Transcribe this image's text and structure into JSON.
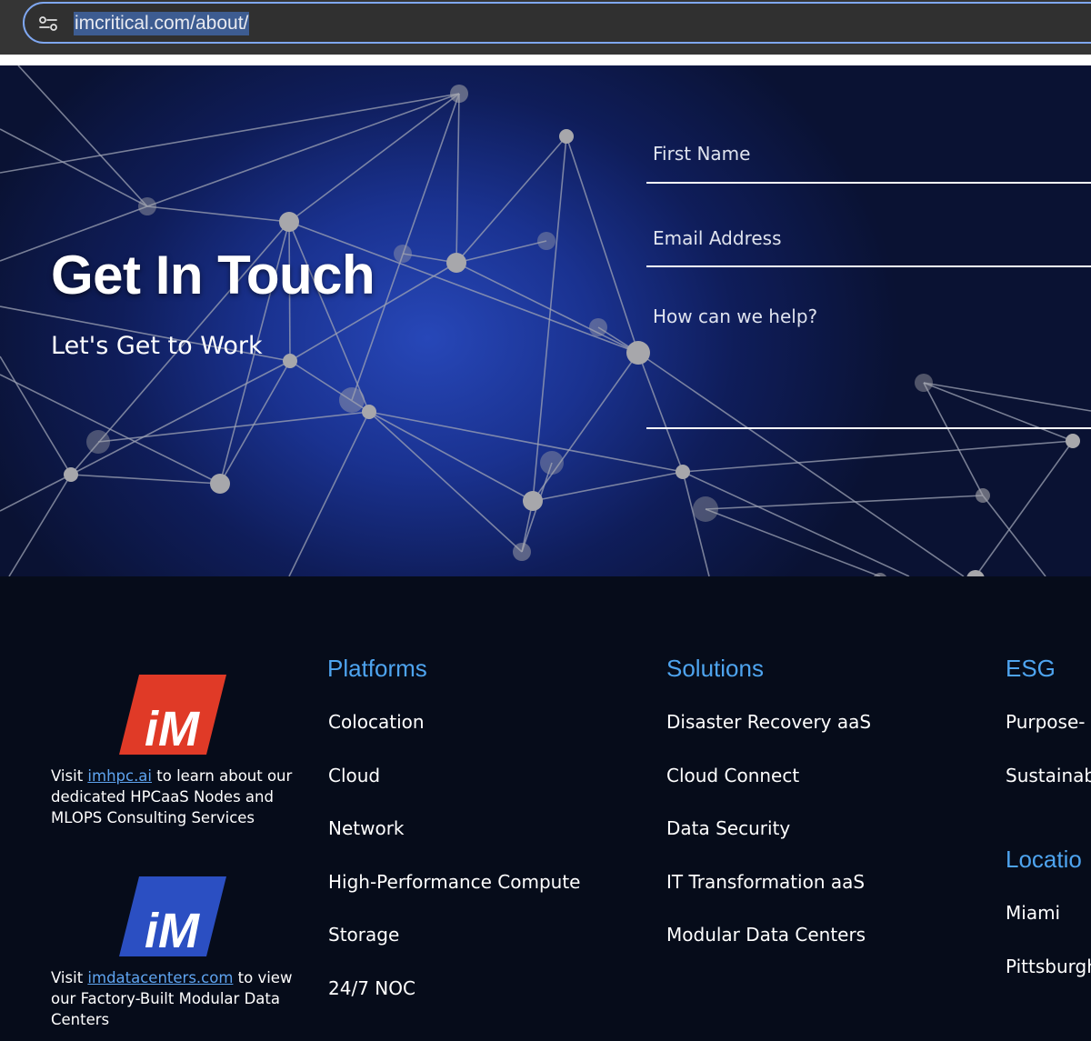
{
  "browser": {
    "url": "imcritical.com/about/",
    "site_settings_icon": "tune-icon"
  },
  "hero": {
    "title": "Get In Touch",
    "subtitle": "Let's Get to Work",
    "form": {
      "first_name_placeholder": "First Name",
      "email_placeholder": "Email Address",
      "help_placeholder": "How can we help?"
    }
  },
  "footer": {
    "logos": [
      {
        "color": "#e03a27",
        "icon": "im-logo-red",
        "prefix": "Visit ",
        "link": "imhpc.ai",
        "suffix": " to learn about our dedicated HPCaaS Nodes and MLOPS Consulting Services"
      },
      {
        "color": "#2b4fc2",
        "icon": "im-logo-blue",
        "prefix": "Visit ",
        "link": "imdatacenters.com",
        "suffix": " to view our Factory-Built Modular Data Centers"
      }
    ],
    "link_color": "#5fa4f0",
    "heading_color": "#4ea4ef",
    "platforms": {
      "heading": "Platforms",
      "items": [
        "Colocation",
        "Cloud",
        "Network",
        "High-Performance Compute",
        "Storage",
        "24/7 NOC"
      ]
    },
    "solutions": {
      "heading": "Solutions",
      "items": [
        "Disaster Recovery aaS",
        "Cloud Connect",
        "Data Security",
        "IT Transformation aaS",
        "Modular Data Centers"
      ]
    },
    "esg": {
      "heading": "ESG",
      "items": [
        "Purpose-",
        "Sustainab"
      ]
    },
    "locations": {
      "heading": "Locatio",
      "items": [
        "Miami",
        "Pittsburgh"
      ]
    }
  }
}
